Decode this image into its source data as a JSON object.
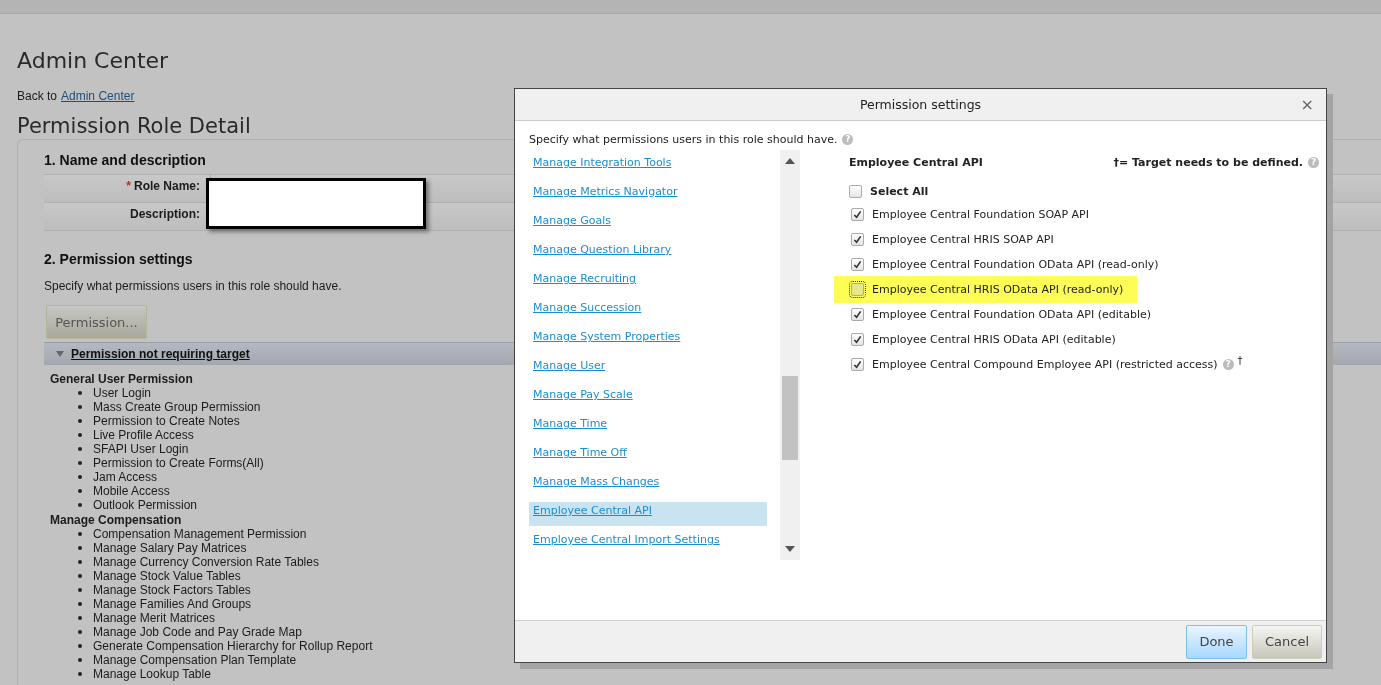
{
  "page": {
    "title": "Admin Center",
    "back_prefix": "Back to",
    "back_link": "Admin Center",
    "heading": "Permission Role Detail"
  },
  "name_section": {
    "title": "1. Name and description",
    "required_mark": "*",
    "fields": [
      {
        "label": "Role Name:",
        "required": true
      },
      {
        "label": "Description:",
        "required": false
      }
    ]
  },
  "permission_section": {
    "title": "2. Permission settings",
    "instruction": "Specify what permissions users in this role should have.",
    "button": "Permission...",
    "group_header": "Permission not requiring target",
    "expanded": true,
    "groups": [
      {
        "title": "General User Permission",
        "items": [
          "User Login",
          "Mass Create Group Permission",
          "Permission to Create Notes",
          "Live Profile Access",
          "SFAPI User Login",
          "Permission to Create Forms(All)",
          "Jam Access",
          "Mobile Access",
          "Outlook Permission"
        ]
      },
      {
        "title": "Manage Compensation",
        "items": [
          "Compensation Management Permission",
          "Manage Salary Pay Matrices",
          "Manage Currency Conversion Rate Tables",
          "Manage Stock Value Tables",
          "Manage Stock Factors Tables",
          "Manage Families And Groups",
          "Manage Merit Matrices",
          "Manage Job Code and Pay Grade Map",
          "Generate Compensation Hierarchy for Rollup Report",
          "Manage Compensation Plan Template",
          "Manage Lookup Table"
        ]
      }
    ]
  },
  "dialog": {
    "title": "Permission settings",
    "close": "×",
    "instruction": "Specify what permissions users in this role should have.",
    "instruction_help": "?",
    "categories": [
      {
        "label": "Manage Integration Tools",
        "selected": false
      },
      {
        "label": "Manage Metrics Navigator",
        "selected": false
      },
      {
        "label": "Manage Goals",
        "selected": false
      },
      {
        "label": "Manage Question Library",
        "selected": false
      },
      {
        "label": "Manage Recruiting",
        "selected": false
      },
      {
        "label": "Manage Succession",
        "selected": false
      },
      {
        "label": "Manage System Properties",
        "selected": false
      },
      {
        "label": "Manage User",
        "selected": false
      },
      {
        "label": "Manage Pay Scale",
        "selected": false
      },
      {
        "label": "Manage Time",
        "selected": false
      },
      {
        "label": "Manage Time Off",
        "selected": false
      },
      {
        "label": "Manage Mass Changes",
        "selected": false
      },
      {
        "label": "Employee Central API",
        "selected": true
      },
      {
        "label": "Employee Central Import Settings",
        "selected": false
      }
    ],
    "panel_title": "Employee Central API",
    "legend": "†= Target needs to be defined.",
    "legend_help": "?",
    "select_all": {
      "label": "Select All",
      "checked": false
    },
    "permissions": [
      {
        "label": "Employee Central Foundation SOAP API",
        "checked": true,
        "highlighted": false
      },
      {
        "label": "Employee Central HRIS SOAP API",
        "checked": true,
        "highlighted": false
      },
      {
        "label": "Employee Central Foundation OData API (read-only)",
        "checked": true,
        "highlighted": false
      },
      {
        "label": "Employee Central HRIS OData API (read-only)",
        "checked": false,
        "highlighted": true
      },
      {
        "label": "Employee Central Foundation OData API (editable)",
        "checked": true,
        "highlighted": false
      },
      {
        "label": "Employee Central HRIS OData API (editable)",
        "checked": true,
        "highlighted": false
      },
      {
        "label": "Employee Central Compound Employee API (restricted access)",
        "checked": true,
        "highlighted": false,
        "help": "?",
        "target_mark": "†"
      }
    ],
    "buttons": [
      {
        "label": "Done",
        "kind": "primary"
      },
      {
        "label": "Cancel",
        "kind": "secondary"
      }
    ]
  }
}
